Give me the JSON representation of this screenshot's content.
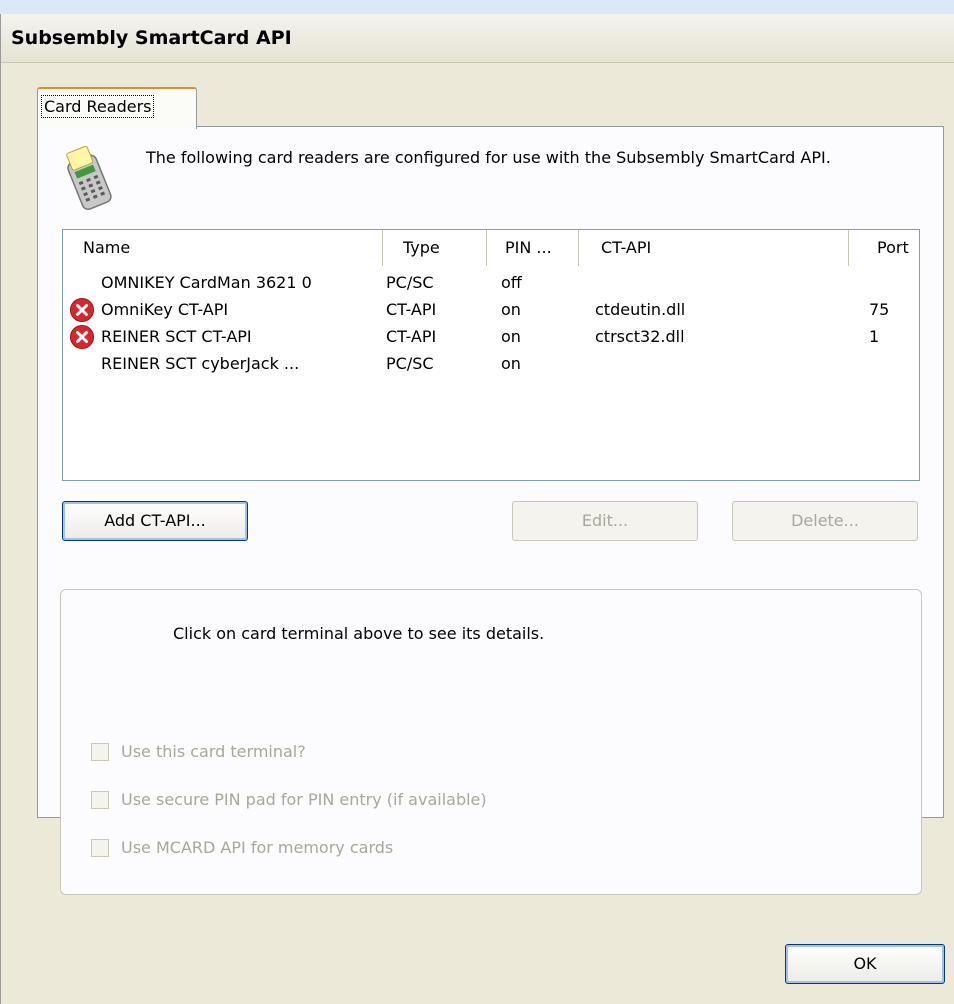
{
  "window": {
    "title": "Subsembly SmartCard API"
  },
  "tabs": [
    {
      "label": "Card Readers"
    }
  ],
  "intro_text": "The following card readers are configured for use with the Subsembly SmartCard API.",
  "readers_list": {
    "columns": [
      "Name",
      "Type",
      "PIN ...",
      "CT-API",
      "Port"
    ],
    "rows": [
      {
        "name": "OMNIKEY CardMan 3621 0",
        "type": "PC/SC",
        "pin": "off",
        "ctapi": "",
        "port": "",
        "status": "ok"
      },
      {
        "name": "OmniKey CT-API",
        "type": "CT-API",
        "pin": "on",
        "ctapi": "ctdeutin.dll",
        "port": "75",
        "status": "error"
      },
      {
        "name": "REINER SCT CT-API",
        "type": "CT-API",
        "pin": "on",
        "ctapi": "ctrsct32.dll",
        "port": "1",
        "status": "error"
      },
      {
        "name": "REINER SCT cyberJack ...",
        "type": "PC/SC",
        "pin": "on",
        "ctapi": "",
        "port": "",
        "status": "ok"
      }
    ]
  },
  "buttons": {
    "add": "Add CT-API...",
    "edit": "Edit...",
    "delete": "Delete...",
    "ok": "OK"
  },
  "details": {
    "message": "Click on card terminal above to see its details.",
    "options": [
      {
        "label": "Use this card terminal?",
        "checked": false,
        "enabled": false
      },
      {
        "label": "Use secure PIN pad for PIN entry (if available)",
        "checked": false,
        "enabled": false
      },
      {
        "label": "Use MCARD API for memory cards",
        "checked": false,
        "enabled": false
      }
    ]
  },
  "icons": {
    "info": "card-reader-icon",
    "error": "error-icon"
  },
  "colors": {
    "error_red": "#d7262c",
    "tab_accent": "#e68b2c",
    "dialog_bg": "#ece9d8"
  }
}
